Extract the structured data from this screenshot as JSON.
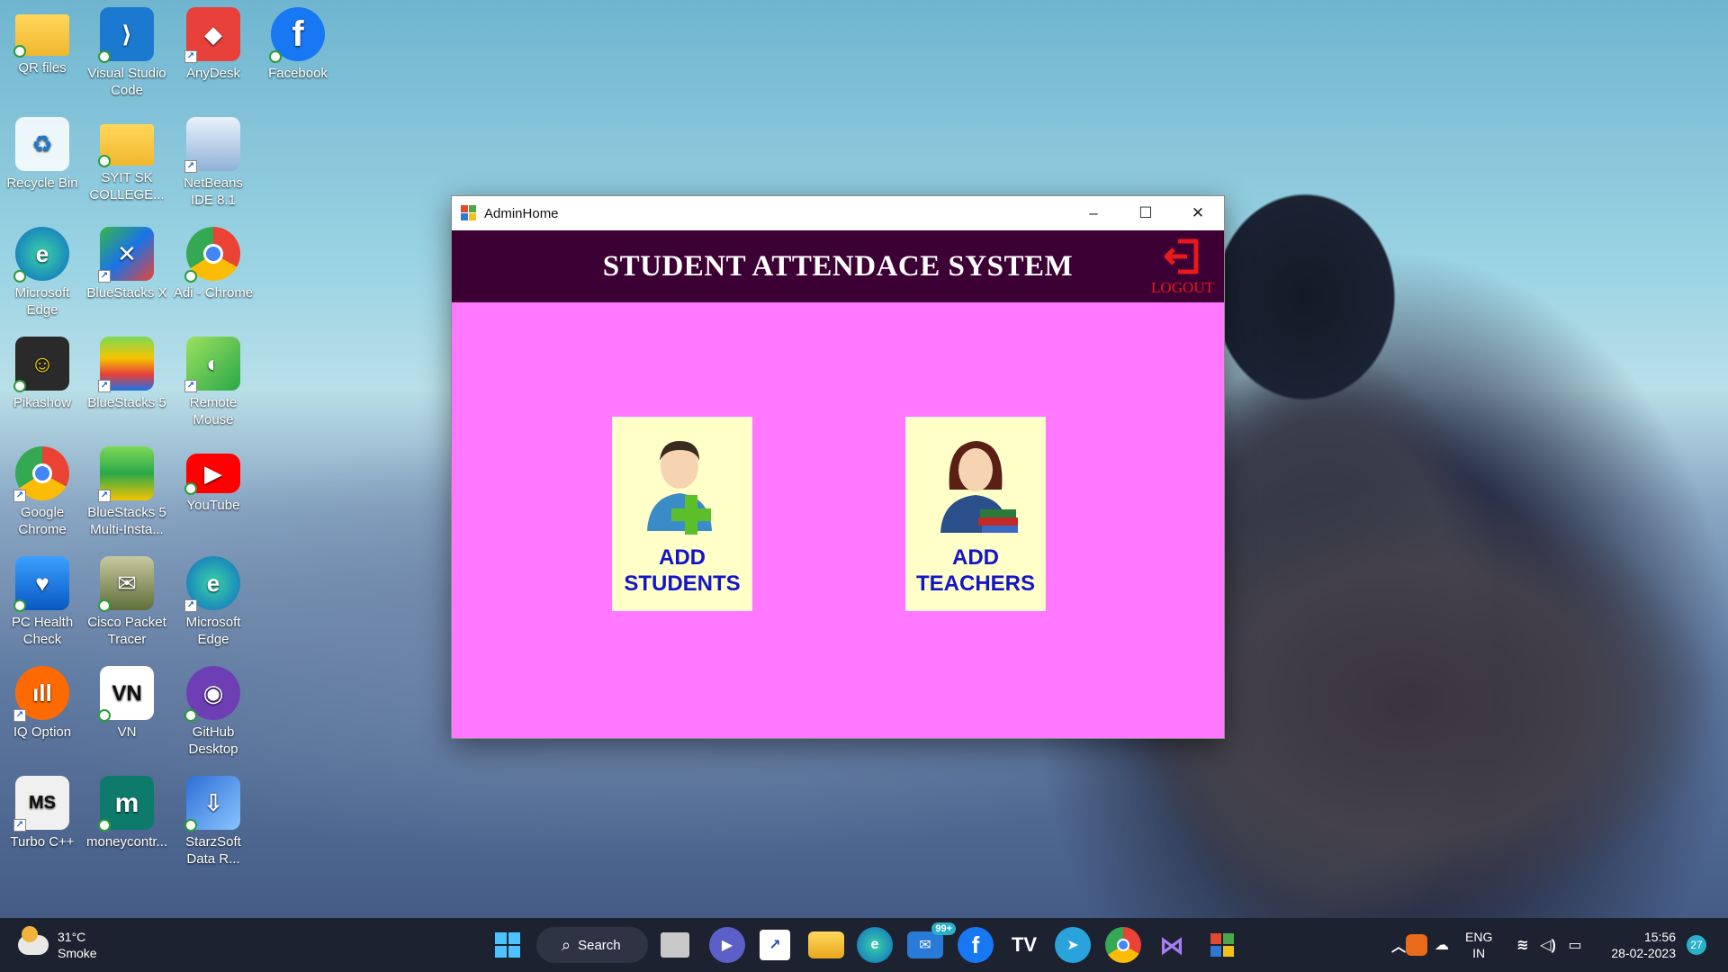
{
  "desktop": {
    "icons": [
      {
        "label": "QR files",
        "icon": "folder-icon"
      },
      {
        "label": "Visual Studio Code",
        "icon": "vscode-icon"
      },
      {
        "label": "AnyDesk",
        "icon": "anydesk-icon"
      },
      {
        "label": "Facebook",
        "icon": "facebook-icon"
      },
      {
        "label": "Recycle Bin",
        "icon": "recycle-bin-icon"
      },
      {
        "label": "SYIT SK COLLEGE...",
        "icon": "folder-icon"
      },
      {
        "label": "NetBeans IDE 8.1",
        "icon": "netbeans-icon"
      },
      {
        "label": "Microsoft Edge",
        "icon": "edge-icon"
      },
      {
        "label": "BlueStacks X",
        "icon": "bluestacks-x-icon"
      },
      {
        "label": "Adi - Chrome",
        "icon": "chrome-icon"
      },
      {
        "label": "Pikashow",
        "icon": "pikashow-icon"
      },
      {
        "label": "BlueStacks 5",
        "icon": "bluestacks-icon"
      },
      {
        "label": "Remote Mouse",
        "icon": "remote-mouse-icon"
      },
      {
        "label": "Google Chrome",
        "icon": "chrome-icon"
      },
      {
        "label": "BlueStacks 5 Multi-Insta...",
        "icon": "bluestacks-multi-icon"
      },
      {
        "label": "YouTube",
        "icon": "youtube-icon"
      },
      {
        "label": "PC Health Check",
        "icon": "pc-health-icon"
      },
      {
        "label": "Cisco Packet Tracer",
        "icon": "cisco-icon"
      },
      {
        "label": "Microsoft Edge",
        "icon": "edge-icon"
      },
      {
        "label": "IQ Option",
        "icon": "iq-option-icon"
      },
      {
        "label": "VN",
        "icon": "vn-icon"
      },
      {
        "label": "GitHub Desktop",
        "icon": "github-icon"
      },
      {
        "label": "Turbo C++",
        "icon": "turbo-c-icon"
      },
      {
        "label": "moneycontr...",
        "icon": "moneycontrol-icon"
      },
      {
        "label": "StarzSoft Data R...",
        "icon": "starzsoft-icon"
      }
    ]
  },
  "window": {
    "title": "AdminHome",
    "minimize": "–",
    "maximize": "☐",
    "close": "✕",
    "header_title": "STUDENT ATTENDACE SYSTEM",
    "logout_label": "LOGOUT",
    "add_students_line1": "ADD",
    "add_students_line2": "STUDENTS",
    "add_teachers_line1": "ADD",
    "add_teachers_line2": "TEACHERS"
  },
  "taskbar": {
    "weather_temp": "31°C",
    "weather_desc": "Smoke",
    "search_label": "Search",
    "mail_badge": "99+",
    "lang_line1": "ENG",
    "lang_line2": "IN",
    "time": "15:56",
    "date": "28-02-2023",
    "notif_count": "27"
  },
  "colors": {
    "window_bg": "#ff78ff",
    "header_bg": "#3d0035",
    "card_bg": "#ffffc8",
    "card_text": "#1414c8",
    "logout_red": "#e8181c"
  }
}
